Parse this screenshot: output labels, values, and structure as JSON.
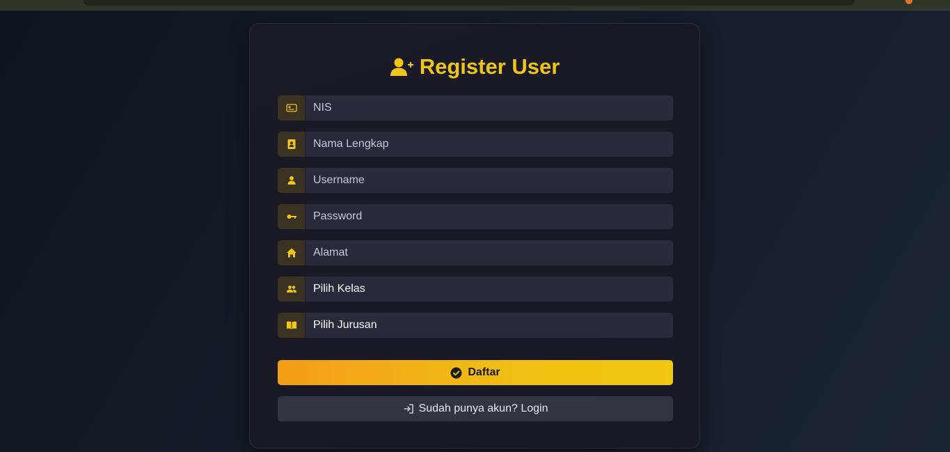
{
  "form": {
    "title": "Register User",
    "fields": [
      {
        "placeholder": "NIS",
        "icon": "id-card-icon"
      },
      {
        "placeholder": "Nama Lengkap",
        "icon": "contact-book-icon"
      },
      {
        "placeholder": "Username",
        "icon": "user-icon"
      },
      {
        "placeholder": "Password",
        "icon": "key-icon"
      },
      {
        "placeholder": "Alamat",
        "icon": "house-icon"
      }
    ],
    "selects": [
      {
        "value": "Pilih Kelas",
        "icon": "people-icon"
      },
      {
        "value": "Pilih Jurusan",
        "icon": "book-icon"
      }
    ],
    "submit_label": "Daftar",
    "login_label": "Sudah punya akun? Login"
  },
  "colors": {
    "accent": "#f0c419",
    "card_bg": "#1b1b26",
    "input_bg": "#2a2a38",
    "icon_bg": "#3a3322"
  }
}
